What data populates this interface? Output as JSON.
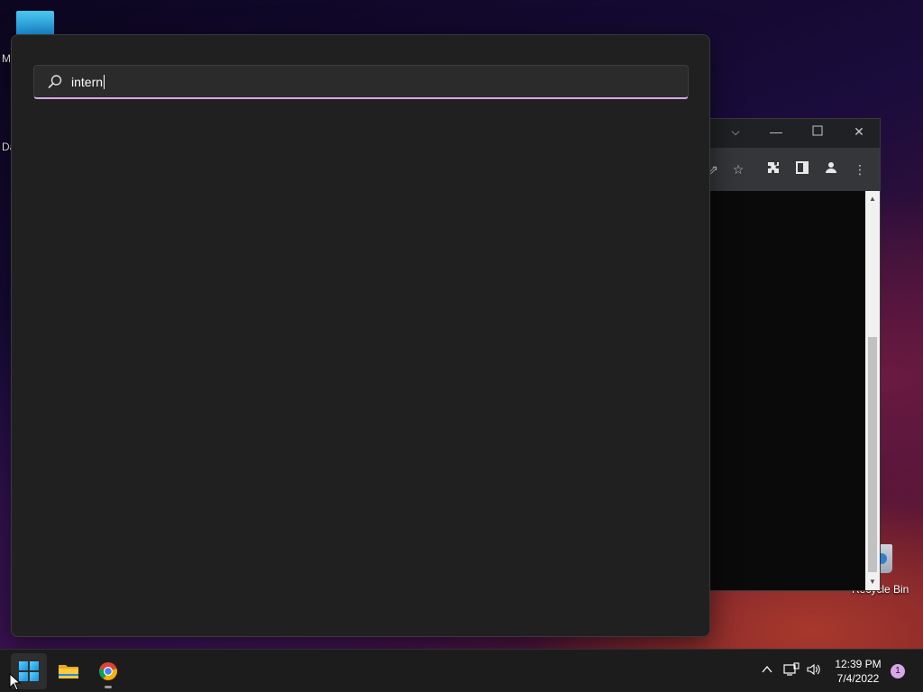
{
  "desktop": {
    "icon_labels": [
      "M",
      "Da"
    ],
    "recycle_bin_label": "Recycle Bin"
  },
  "browser": {
    "titlebar_buttons": [
      "chevron-down-icon",
      "minimize-icon",
      "maximize-icon",
      "close-icon"
    ],
    "toolbar_icons": [
      "share-icon",
      "star-icon",
      "extensions-icon",
      "side-panel-icon",
      "profile-icon",
      "more-icon"
    ]
  },
  "search": {
    "query": "intern"
  },
  "taskbar": {
    "apps": [
      "start-icon",
      "file-explorer-icon",
      "chrome-icon"
    ],
    "tray": [
      "chevron-up-icon",
      "network-icon",
      "volume-icon"
    ],
    "time": "12:39 PM",
    "date": "7/4/2022",
    "notification_count": "1"
  },
  "colors": {
    "panel_bg": "#202020",
    "search_accent": "#d9a6e8",
    "taskbar_bg": "#1c1c1c"
  }
}
